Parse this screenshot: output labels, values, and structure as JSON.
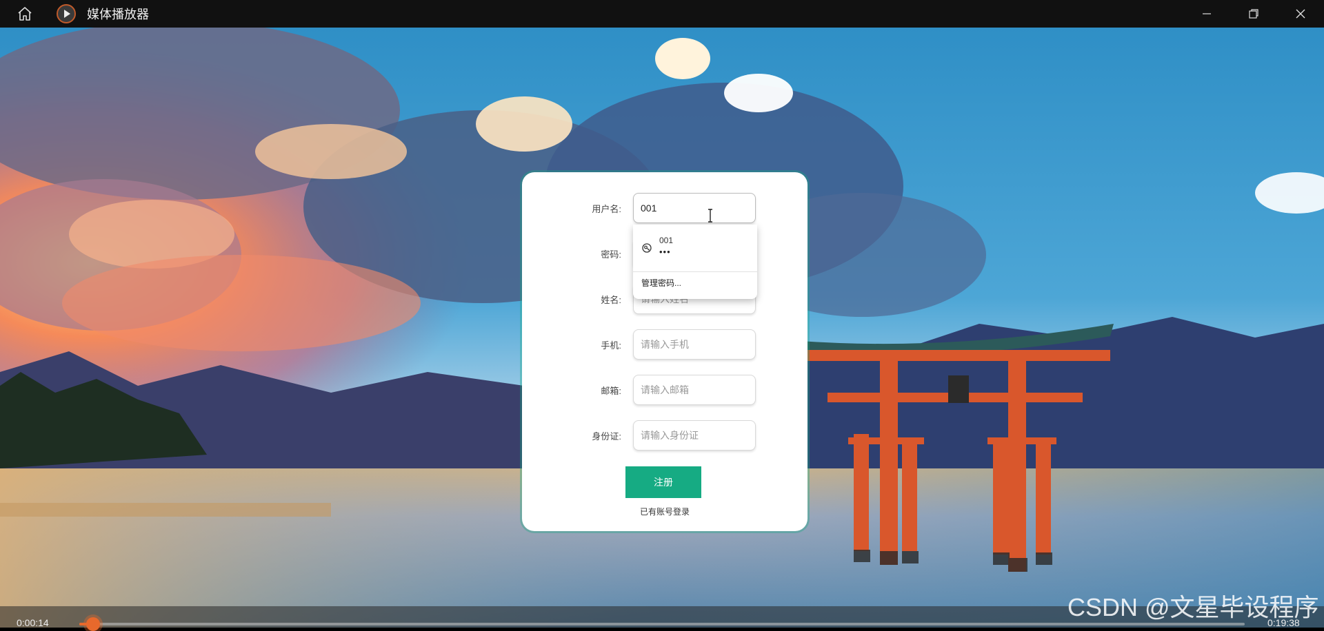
{
  "window": {
    "title": "媒体播放器",
    "icons": {
      "home": "home-icon",
      "logo": "play-logo-icon",
      "minimize": "minimize-icon",
      "restore": "restore-icon",
      "close": "close-icon"
    }
  },
  "form": {
    "fields": [
      {
        "label": "用户名:",
        "value": "001",
        "placeholder": ""
      },
      {
        "label": "密码:",
        "value": "",
        "placeholder": ""
      },
      {
        "label": "姓名:",
        "value": "",
        "placeholder": "请输入姓名"
      },
      {
        "label": "手机:",
        "value": "",
        "placeholder": "请输入手机"
      },
      {
        "label": "邮箱:",
        "value": "",
        "placeholder": "请输入邮箱"
      },
      {
        "label": "身份证:",
        "value": "",
        "placeholder": "请输入身份证"
      }
    ],
    "register_button": "注册",
    "login_link": "已有账号登录",
    "accent_color": "#16ab83"
  },
  "autofill": {
    "username": "001",
    "password_mask": "•••",
    "icon": "key-icon",
    "manage_label": "管理密码..."
  },
  "player": {
    "current_time": "0:00:14",
    "total_time": "0:19:38",
    "progress": 0.012,
    "accent_color": "#e8692c"
  },
  "watermark": "CSDN @文星毕设程序"
}
